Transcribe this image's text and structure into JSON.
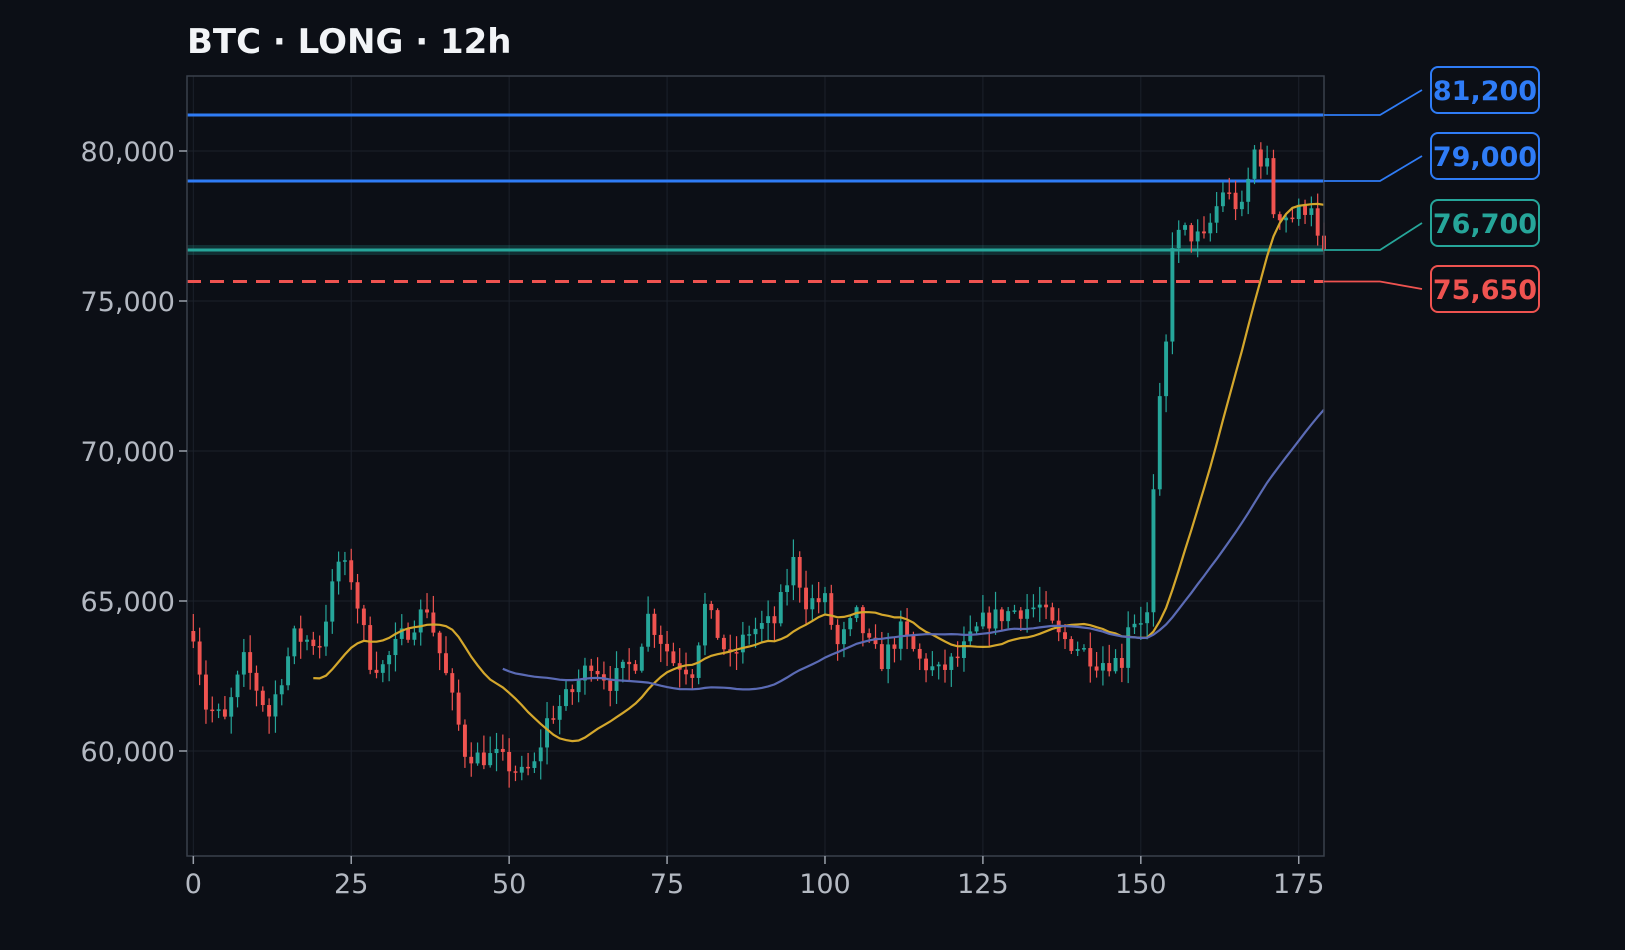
{
  "chart_data": {
    "type": "candlestick",
    "title": "BTC · LONG · 12h",
    "xlabel": "",
    "ylabel": "",
    "xlim": [
      -1,
      179
    ],
    "ylim": [
      56500,
      82500
    ],
    "x_ticks": [
      0,
      25,
      50,
      75,
      100,
      125,
      150,
      175
    ],
    "x_tick_labels": [
      "0",
      "25",
      "50",
      "75",
      "100",
      "125",
      "150",
      "175"
    ],
    "y_ticks": [
      60000,
      65000,
      70000,
      75000,
      80000
    ],
    "y_tick_labels": [
      "60,000",
      "65,000",
      "70,000",
      "75,000",
      "80,000"
    ],
    "grid": true,
    "colors": {
      "background": "#0c0f16",
      "grid": "#1c212b",
      "up": "#26a69a",
      "down": "#ef5350",
      "ma_fast": "#d4a72c",
      "ma_slow": "#5b6bb5",
      "target": "#2f7cf6",
      "entry": "#26a69a",
      "stop": "#ef5350"
    },
    "levels": [
      {
        "kind": "target",
        "value": 81200,
        "label": "81,200",
        "style": "solid"
      },
      {
        "kind": "target",
        "value": 79000,
        "label": "79,000",
        "style": "solid"
      },
      {
        "kind": "entry",
        "value": 76700,
        "label": "76,700",
        "style": "solid"
      },
      {
        "kind": "stop",
        "value": 75650,
        "label": "75,650",
        "style": "dashed"
      }
    ],
    "ohlc_waypoints": [
      [
        0,
        64000
      ],
      [
        2,
        61500
      ],
      [
        5,
        61000
      ],
      [
        8,
        63000
      ],
      [
        12,
        61200
      ],
      [
        16,
        63800
      ],
      [
        20,
        63600
      ],
      [
        23,
        66300
      ],
      [
        25,
        65800
      ],
      [
        28,
        63000
      ],
      [
        30,
        62800
      ],
      [
        33,
        63800
      ],
      [
        37,
        64800
      ],
      [
        40,
        62500
      ],
      [
        43,
        60000
      ],
      [
        45,
        59800
      ],
      [
        48,
        59800
      ],
      [
        52,
        59200
      ],
      [
        54,
        59500
      ],
      [
        56,
        61000
      ],
      [
        60,
        62000
      ],
      [
        63,
        63000
      ],
      [
        66,
        62300
      ],
      [
        70,
        63000
      ],
      [
        72,
        64500
      ],
      [
        76,
        63000
      ],
      [
        79,
        62700
      ],
      [
        81,
        64800
      ],
      [
        85,
        63000
      ],
      [
        88,
        64000
      ],
      [
        92,
        64300
      ],
      [
        95,
        66300
      ],
      [
        97,
        65000
      ],
      [
        100,
        65000
      ],
      [
        102,
        63500
      ],
      [
        105,
        64500
      ],
      [
        107,
        63500
      ],
      [
        109,
        63000
      ],
      [
        112,
        64000
      ],
      [
        115,
        63000
      ],
      [
        118,
        62600
      ],
      [
        121,
        63100
      ],
      [
        125,
        64300
      ],
      [
        130,
        64700
      ],
      [
        134,
        64800
      ],
      [
        137,
        63800
      ],
      [
        140,
        63500
      ],
      [
        143,
        63000
      ],
      [
        147,
        63000
      ],
      [
        148,
        64300
      ],
      [
        151,
        64500
      ],
      [
        152,
        68500
      ],
      [
        153,
        71500
      ],
      [
        154,
        73500
      ],
      [
        155,
        77000
      ],
      [
        157,
        77300
      ],
      [
        160,
        77000
      ],
      [
        163,
        78700
      ],
      [
        166,
        78000
      ],
      [
        168,
        80000
      ],
      [
        170,
        79500
      ],
      [
        171,
        78000
      ],
      [
        174,
        77800
      ],
      [
        177,
        78300
      ],
      [
        178,
        77000
      ],
      [
        179,
        76700
      ]
    ],
    "moving_averages": [
      {
        "name": "ma_fast",
        "period": 20,
        "color_key": "ma_fast"
      },
      {
        "name": "ma_slow",
        "period": 50,
        "color_key": "ma_slow"
      }
    ],
    "candle_count": 180
  }
}
